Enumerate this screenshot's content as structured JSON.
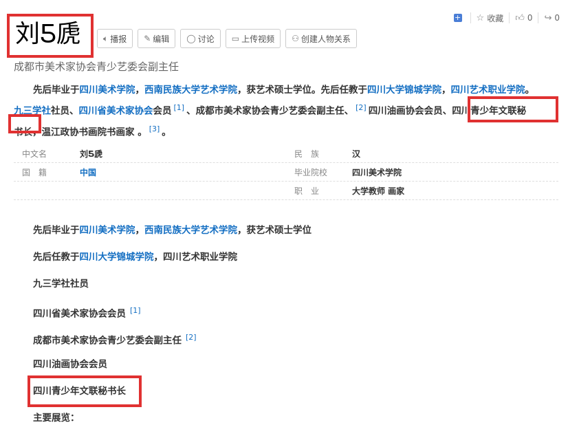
{
  "toolbar": {
    "add_icon": "plus-square-icon",
    "favorite_label": "收藏",
    "like_count": "0",
    "share_count": "0"
  },
  "person": {
    "name": "刘Ƽ虒",
    "subtitle": "成都市美术家协会青少艺委会副主任"
  },
  "actions": [
    {
      "label": "播报",
      "icon": "speaker-icon"
    },
    {
      "label": "编辑",
      "icon": "pencil-icon"
    },
    {
      "label": "讨论",
      "icon": "chat-icon"
    },
    {
      "label": "上传视频",
      "icon": "video-icon"
    },
    {
      "label": "创建人物关系",
      "icon": "relation-icon"
    }
  ],
  "intro": {
    "t1": "先后毕业于",
    "l1": "四川美术学院",
    "t2": "，",
    "l2": "西南民族大学艺术学院",
    "t3": "，获艺术硕士学位。先后任教于",
    "l3": "四川大学锦城学院",
    "t4": "，",
    "l4": "四川艺术职业学院",
    "t5": "。",
    "l5": "九三学社",
    "t6": "社员、",
    "l6": "四川省美术家协会",
    "t7": "会员",
    "r1": "[1]",
    "t8": "、成都市美术家协会青少艺委会副主任、",
    "r2": "[2]",
    "t9": "四川油画协会会员、",
    "t10": "四川青少年文联秘",
    "t11": "书长",
    "t12": "，温江政协书画院书画家 。",
    "r3": "[3]",
    "t13": "。"
  },
  "info": {
    "chinese_name_label": "中文名",
    "chinese_name": "刘Ƽ虒",
    "nationality_label": "国　籍",
    "nationality": "中国",
    "ethnicity_label": "民　族",
    "ethnicity": "汉",
    "school_label": "毕业院校",
    "school": "四川美术学院",
    "job_label": "职　业",
    "job": "大学教师 画家"
  },
  "list": {
    "i1a": "先后毕业于",
    "i1b": "四川美术学院",
    "i1c": "，",
    "i1d": "西南民族大学艺术学院",
    "i1e": "，获艺术硕士学位",
    "i2a": "先后任教于",
    "i2b": "四川大学锦城学院",
    "i2c": "，四川艺术职业学院",
    "i3": "九三学社社员",
    "i4": "四川省美术家协会会员",
    "i4r": "[1]",
    "i5": "成都市美术家协会青少艺委会副主任",
    "i5r": "[2]",
    "i6": "四川油画协会会员",
    "i7": "四川青少年文联秘书长",
    "i8": "主要展览："
  }
}
